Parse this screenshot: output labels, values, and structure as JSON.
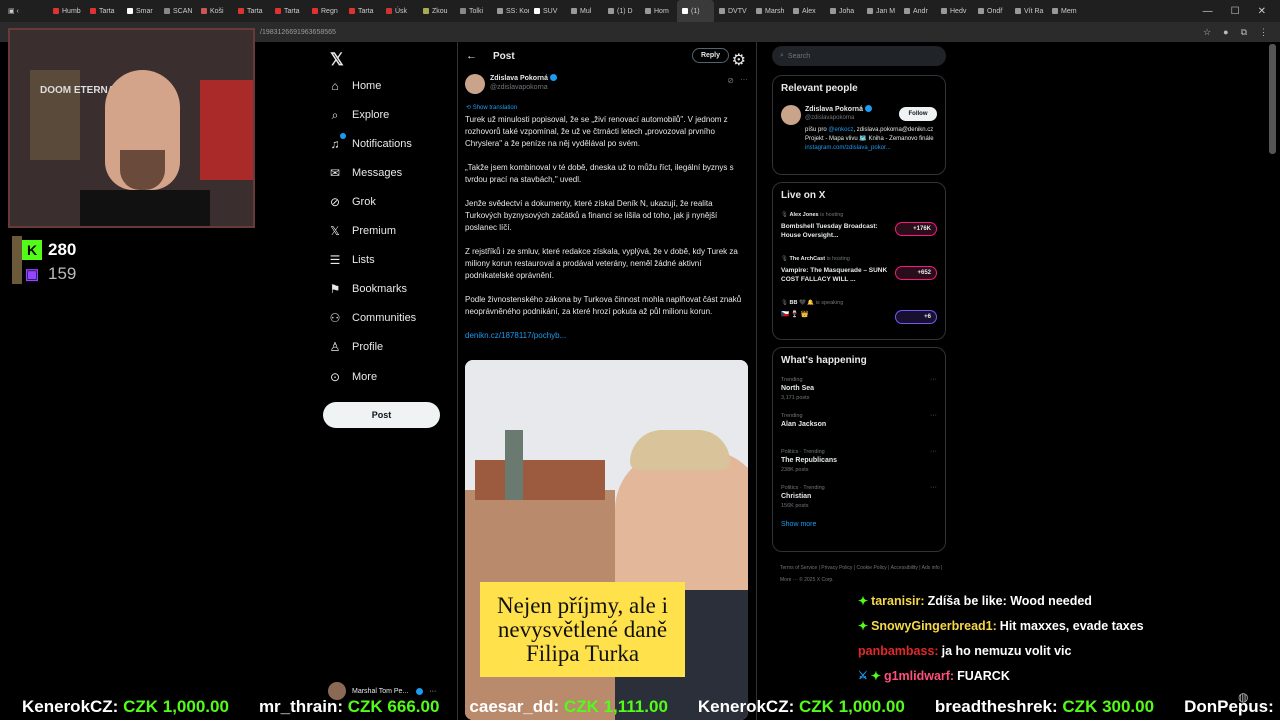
{
  "browser": {
    "tabs": [
      "Humb",
      "Tarta",
      "Smar",
      "SCAN",
      "Koši",
      "Tarta",
      "Tarta",
      "Regn",
      "Tarta",
      "Úsk",
      "Zkou",
      "Tolki",
      "SS: Kome",
      "SUV",
      "Mul",
      "(1) D",
      "Hom",
      "(1)",
      "DVTV",
      "Marsh",
      "Alex",
      "Joha",
      "Jan M",
      "Andr",
      "Hedv",
      "Ondř",
      "Vít Ra",
      "Mem"
    ],
    "url": "/1983126691963658565"
  },
  "nav": {
    "items": [
      {
        "label": "Home",
        "icon": "home-icon"
      },
      {
        "label": "Explore",
        "icon": "search-icon"
      },
      {
        "label": "Notifications",
        "icon": "bell-icon"
      },
      {
        "label": "Messages",
        "icon": "mail-icon"
      },
      {
        "label": "Grok",
        "icon": "grok-icon"
      },
      {
        "label": "Premium",
        "icon": "x-icon"
      },
      {
        "label": "Lists",
        "icon": "list-icon"
      },
      {
        "label": "Bookmarks",
        "icon": "bookmark-icon"
      },
      {
        "label": "Communities",
        "icon": "people-icon"
      },
      {
        "label": "Profile",
        "icon": "person-icon"
      },
      {
        "label": "More",
        "icon": "more-circle-icon"
      }
    ],
    "post_label": "Post",
    "account_name": "Marshal Tom Pe..."
  },
  "post": {
    "header_title": "Post",
    "reply_label": "Reply",
    "author_name": "Zdislava Pokorná",
    "author_handle": "@zdislavapokorna",
    "translate_label": "Show translation",
    "paragraphs": [
      "Turek už minulosti popisoval, že se „živí renovací automobilů\". V jednom z rozhovorů také vzpomínal, že už ve čtrnácti letech „provozoval prvního Chryslera\" a že peníze na něj vydělával po svém.",
      "„Takže jsem kombinoval v té době, dneska už to můžu říct, ilegální byznys s tvrdou prací na stavbách,\" uvedl.",
      "Jenže svědectví a dokumenty, které získal Deník N, ukazují, že realita Turkových byznysových začátků a financí se lišila od toho, jak ji nynější poslanec líčí.",
      "Z rejstříků i ze smluv, které redakce získala, vyplývá, že v době, kdy Turek za miliony korun restauroval a prodával veterány, neměl žádné aktivní podnikatelské oprávnění.",
      "Podle živnostenského zákona by Turkova činnost mohla naplňovat část znaků neoprávněného podnikání, za které hrozí pokuta až půl milionu korun."
    ],
    "link": "denikn.cz/1878117/pochyb...",
    "image_caption": "Nejen příjmy, ale i nevysvětlené daně Filipa Turka"
  },
  "right": {
    "search_placeholder": "Search",
    "relevant_title": "Relevant people",
    "person": {
      "name": "Zdislava Pokorná",
      "handle": "@zdislavapokorna",
      "follow_label": "Follow",
      "bio_prefix": "píšu pro ",
      "bio_link": "@enkocz",
      "bio_rest": ", zdislava.pokorna@denikn.cz Projekt - Mapa vlivu 🗺️ Kniha - Zemanovo finále",
      "bio_url": "instagram.com/zdislava_pokor..."
    },
    "live_title": "Live on X",
    "live": [
      {
        "host": "Alex Jones",
        "status": "is hosting",
        "title": "Bombshell Tuesday Broadcast: House Oversight...",
        "count": "+176K"
      },
      {
        "host": "The ArchCast",
        "status": "is hosting",
        "title": "Vampire: The Masquerade – SUNK COST FALLACY WILL ...",
        "count": "+652"
      },
      {
        "host": "BB 🖤 🔔",
        "status": "is speaking",
        "title": "🇨🇿 🍷 👑",
        "count": "+6"
      }
    ],
    "happening_title": "What's happening",
    "trends": [
      {
        "context": "Trending",
        "title": "North Sea",
        "count": "3,171 posts"
      },
      {
        "context": "Trending",
        "title": "Alan Jackson",
        "count": ""
      },
      {
        "context": "Politics · Trending",
        "title": "The Republicans",
        "count": "238K posts"
      },
      {
        "context": "Politics · Trending",
        "title": "Christian",
        "count": "156K posts"
      }
    ],
    "show_more": "Show more",
    "footer": "Terms of Service  |  Privacy Policy  |  Cookie Policy  |  Accessibility  |  Ads info  |  More ···  © 2025 X Corp."
  },
  "stream": {
    "kick_count": "280",
    "twitch_count": "159",
    "webcam_label": "DOOM ETERNAL",
    "chat": [
      {
        "user": "taranisir:",
        "color": "#f5d949",
        "msg": "Zdíša be like: Wood needed",
        "badge": "✦"
      },
      {
        "user": "SnowyGingerbread1:",
        "color": "#f5d949",
        "msg": "Hit maxxes, evade taxes",
        "badge": "✦"
      },
      {
        "user": "panbambass:",
        "color": "#e02a2a",
        "msg": "ja ho nemuzu volit vic",
        "badge": ""
      },
      {
        "user": "g1mlidwarf:",
        "color": "#ff4f7a",
        "msg": "FUARCK",
        "badge": "✦"
      }
    ],
    "ticker": [
      {
        "name": "KenerokCZ:",
        "amount": "CZK 1,000.00"
      },
      {
        "name": "mr_thrain:",
        "amount": "CZK 666.00"
      },
      {
        "name": "caesar_dd:",
        "amount": "CZK 1,111.00"
      },
      {
        "name": "KenerokCZ:",
        "amount": "CZK 1,000.00"
      },
      {
        "name": "breadtheshrek:",
        "amount": "CZK 300.00"
      },
      {
        "name": "DonPepus:",
        "amount": ""
      }
    ]
  }
}
